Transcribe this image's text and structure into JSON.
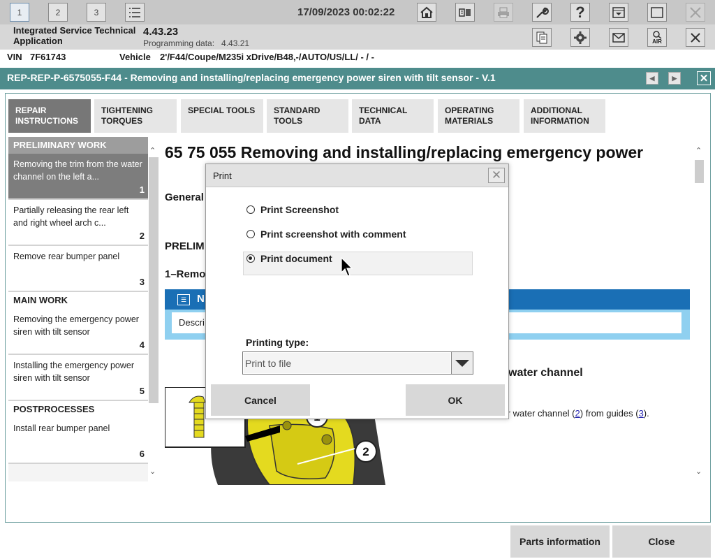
{
  "toolbar": {
    "sessions": [
      "1",
      "2",
      "3"
    ],
    "datetime": "17/09/2023 00:02:22",
    "icons": [
      "list-icon",
      "home-icon",
      "split-view-icon",
      "print-icon",
      "wrench-icon",
      "help-icon",
      "download-icon",
      "window-icon",
      "close-icon"
    ]
  },
  "app": {
    "name": "Integrated Service Technical Application",
    "version": "4.43.23",
    "programming_label": "Programming data:",
    "programming_version": "4.43.21",
    "icons": [
      "documents-icon",
      "settings-icon",
      "mail-icon",
      "air-icon",
      "close-icon"
    ],
    "air_label": "AIR"
  },
  "vehicle_bar": {
    "vin_label": "VIN",
    "vin": "7F61743",
    "vehicle_label": "Vehicle",
    "vehicle": "2'/F44/Coupe/M235i xDrive/B48,-/AUTO/US/LL/ - / -"
  },
  "title": "REP-REP-P-6575055-F44 - Removing and installing/replacing emergency power siren with tilt sensor - V.1",
  "tabs": [
    {
      "line1": "REPAIR",
      "line2": "INSTRUCTIONS",
      "active": true
    },
    {
      "line1": "TIGHTENING",
      "line2": "TORQUES"
    },
    {
      "line1": "SPECIAL TOOLS",
      "line2": ""
    },
    {
      "line1": "STANDARD",
      "line2": "TOOLS"
    },
    {
      "line1": "TECHNICAL",
      "line2": "DATA"
    },
    {
      "line1": "OPERATING",
      "line2": "MATERIALS"
    },
    {
      "line1": "ADDITIONAL",
      "line2": "INFORMATION"
    }
  ],
  "sidebar": {
    "sections": [
      "PRELIMINARY WORK",
      "MAIN WORK",
      "POSTPROCESSES"
    ],
    "items": [
      {
        "text": "Removing the trim from the water channel on the left a...",
        "num": "1"
      },
      {
        "text": "Partially releasing the rear left and right wheel arch c...",
        "num": "2"
      },
      {
        "text": "Remove rear bumper panel",
        "num": "3"
      },
      {
        "text": "Removing the emergency power siren with tilt sensor",
        "num": "4"
      },
      {
        "text": "Installing the emergency power siren with tilt sensor",
        "num": "5"
      },
      {
        "text": "Install rear bumper panel",
        "num": "6"
      }
    ]
  },
  "document": {
    "heading": "65 75 055  Removing and installing/replacing emergency power",
    "general": "General",
    "prelim": "PRELIM",
    "step1": "1–Remo",
    "note_letter": "N",
    "note_text": "Descri",
    "water_channel": "water channel",
    "removal_text_pre": "n for water channel (",
    "ref2": "2",
    "removal_text_mid": ") from guides (",
    "ref3": "3",
    "removal_text_post": ").",
    "callout_1": "1",
    "callout_2": "2"
  },
  "dialog": {
    "title": "Print",
    "options": [
      "Print Screenshot",
      "Print screenshot with comment",
      "Print document"
    ],
    "selected_index": 2,
    "printing_type_label": "Printing type:",
    "printing_type_value": "Print to file",
    "cancel": "Cancel",
    "ok": "OK"
  },
  "bottom": {
    "parts": "Parts information",
    "close": "Close"
  }
}
